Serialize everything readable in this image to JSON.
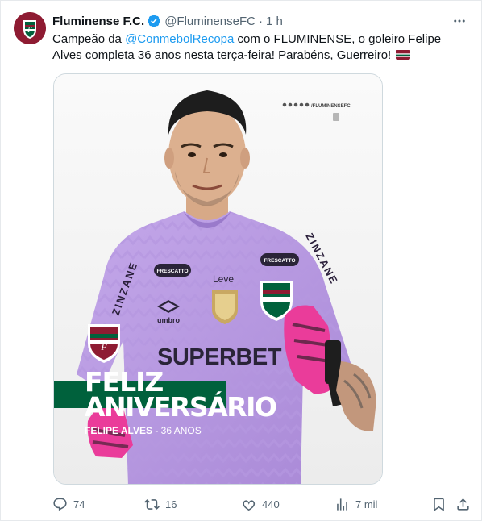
{
  "tweet": {
    "author_name": "Fluminense F.C.",
    "handle": "@FluminenseFC",
    "separator": "·",
    "time": "1 h",
    "text_part1": "Campeão da ",
    "mention": "@ConmebolRecopa",
    "text_part2": " com o FLUMINENSE, o goleiro Felipe Alves completa 36 anos nesta terça-feira! Parabéns, Guerreiro!"
  },
  "media": {
    "title_line1": "FELIZ",
    "title_line2": "ANIVERSÁRIO",
    "subtitle_name": "FELIPE ALVES",
    "subtitle_age": " - 36 ANOS",
    "social_handle": "/FLUMINENSEFC",
    "shirt_sponsor": "SUPERBET",
    "shirt_brand": "umbro",
    "shirt_sleeve": "ZINZANE",
    "shirt_patch": "FRESCATTO",
    "shirt_leve": "Leve",
    "colors": {
      "maroon": "#8e1b32",
      "green": "#00613c",
      "jersey": "#b89be0"
    }
  },
  "actions": {
    "replies": "74",
    "reposts": "16",
    "likes": "440",
    "views": "7 mil"
  },
  "icons": [
    "more-icon",
    "verified-icon",
    "reply-icon",
    "repost-icon",
    "like-icon",
    "views-icon",
    "bookmark-icon",
    "share-icon"
  ]
}
